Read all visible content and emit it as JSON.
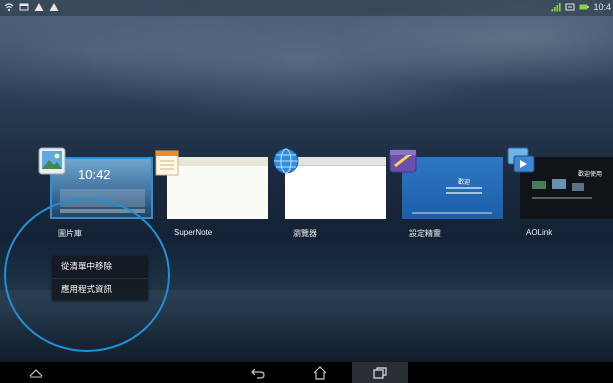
{
  "status_bar": {
    "left_icons": [
      "wifi-icon",
      "gallery-notification-icon",
      "alert-icon",
      "alert-icon"
    ],
    "right_icons": [
      "signal-icon",
      "sync-icon",
      "battery-icon"
    ],
    "time": "10:4"
  },
  "recent_apps": [
    {
      "name": "gallery",
      "label": "圖片庫",
      "icon": "gallery-icon",
      "thumb_time": "10:42"
    },
    {
      "name": "supernote",
      "label": "SuperNote",
      "icon": "notebook-icon"
    },
    {
      "name": "browser",
      "label": "瀏覽器",
      "icon": "globe-icon"
    },
    {
      "name": "setup-wizard",
      "label": "設定精靈",
      "icon": "settings-wizard-icon",
      "thumb_text": "歡迎"
    },
    {
      "name": "aolink",
      "label": "AOLink",
      "icon": "aolink-icon",
      "thumb_text": "歡迎使用"
    }
  ],
  "context_menu": {
    "items": [
      "從清單中移除",
      "應用程式資訊"
    ]
  },
  "nav_bar": {
    "buttons": [
      "menu-up-icon",
      "back-icon",
      "home-icon",
      "recent-apps-icon"
    ]
  },
  "colors": {
    "highlight": "#1f8fd6",
    "nav_bar": "#000000",
    "menu_bg": "#141a22"
  }
}
